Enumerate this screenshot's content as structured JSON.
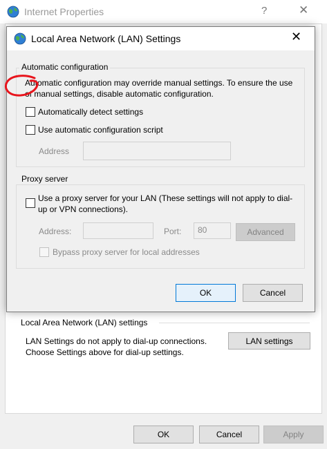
{
  "background_window": {
    "title": "Internet Properties",
    "help_glyph": "?",
    "close_glyph": "✕",
    "lan_group": {
      "label": "Local Area Network (LAN) settings",
      "description": "LAN Settings do not apply to dial-up connections. Choose Settings above for dial-up settings.",
      "button_label": "LAN settings"
    },
    "footer": {
      "ok_label": "OK",
      "cancel_label": "Cancel",
      "apply_label": "Apply"
    }
  },
  "dialog": {
    "title": "Local Area Network (LAN) Settings",
    "close_glyph": "✕",
    "automatic_configuration": {
      "label": "Automatic configuration",
      "description": "Automatic configuration may override manual settings.  To ensure the use of manual settings, disable automatic configuration.",
      "auto_detect": {
        "label": "Automatically detect settings",
        "checked": false
      },
      "use_script": {
        "label": "Use automatic configuration script",
        "checked": false
      },
      "address_label": "Address",
      "address_value": ""
    },
    "proxy_server": {
      "label": "Proxy server",
      "use_proxy": {
        "label": "Use a proxy server for your LAN (These settings will not apply to dial-up or VPN connections).",
        "checked": false
      },
      "address_label": "Address:",
      "address_value": "",
      "port_label": "Port:",
      "port_value": "80",
      "advanced_label": "Advanced",
      "bypass": {
        "label": "Bypass proxy server for local addresses",
        "checked": false
      }
    },
    "footer": {
      "ok_label": "OK",
      "cancel_label": "Cancel"
    }
  },
  "colors": {
    "accent": "#0078d7",
    "annotation_red": "#e8141c"
  },
  "icons": {
    "title_icon": "globe-network-icon"
  }
}
